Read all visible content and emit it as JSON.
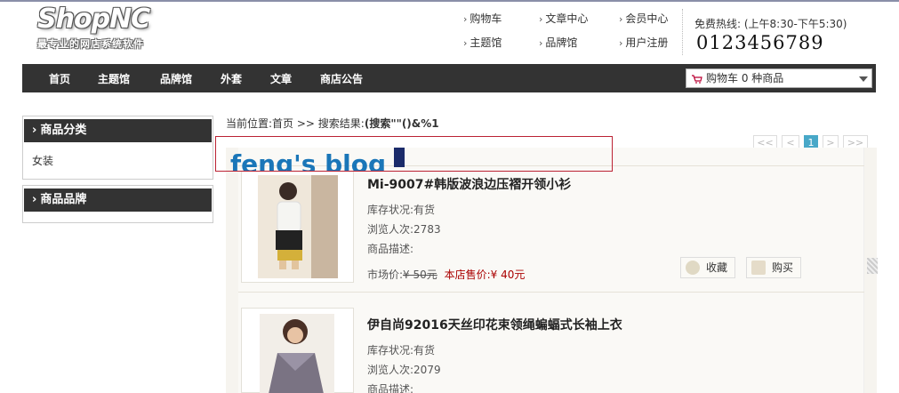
{
  "logo": {
    "main": "ShopNC",
    "sub": "最专业的网店系统软件"
  },
  "top_links": [
    "购物车",
    "文章中心",
    "会员中心",
    "主题馆",
    "品牌馆",
    "用户注册"
  ],
  "hotline": {
    "label": "免费热线: (上午8:30-下午5:30)",
    "number": "0123456789"
  },
  "nav": [
    "首页",
    "主题馆",
    "品牌馆",
    "外套",
    "文章",
    "商店公告"
  ],
  "cart_select": {
    "value": "购物车  0 种商品"
  },
  "sidebar": {
    "category_title": "商品分类",
    "category_items": [
      "女装"
    ],
    "brand_title": "商品品牌"
  },
  "breadcrumb": {
    "prefix": "当前位置:首页  >> 搜索结果:",
    "query": "(搜索\"\"()&%1"
  },
  "pager": {
    "first": "<<",
    "prev": "<",
    "current": "1",
    "next": ">",
    "last": ">>"
  },
  "overlay": {
    "text": "feng's blog"
  },
  "products": [
    {
      "name": "Mi-9007#韩版波浪边压褶开领小衫",
      "stock": "库存状况:有货",
      "views": "浏览人次:2783",
      "desc": "商品描述:",
      "market_label": "市场价:",
      "market_price": "¥ 50元",
      "shop_label": "本店售价:",
      "shop_price": "¥ 40元",
      "fav_label": "收藏",
      "buy_label": "购买"
    },
    {
      "name": "伊自尚92016天丝印花束领绳蝙蝠式长袖上衣",
      "stock": "库存状况:有货",
      "views": "浏览人次:2079",
      "desc": "商品描述:"
    }
  ],
  "colors": {
    "nav_bg": "#333333",
    "pager_active": "#48a8c8",
    "shop_price": "#aa0000",
    "overlay_border": "#bb2233",
    "overlay_text": "#1a76b8"
  }
}
